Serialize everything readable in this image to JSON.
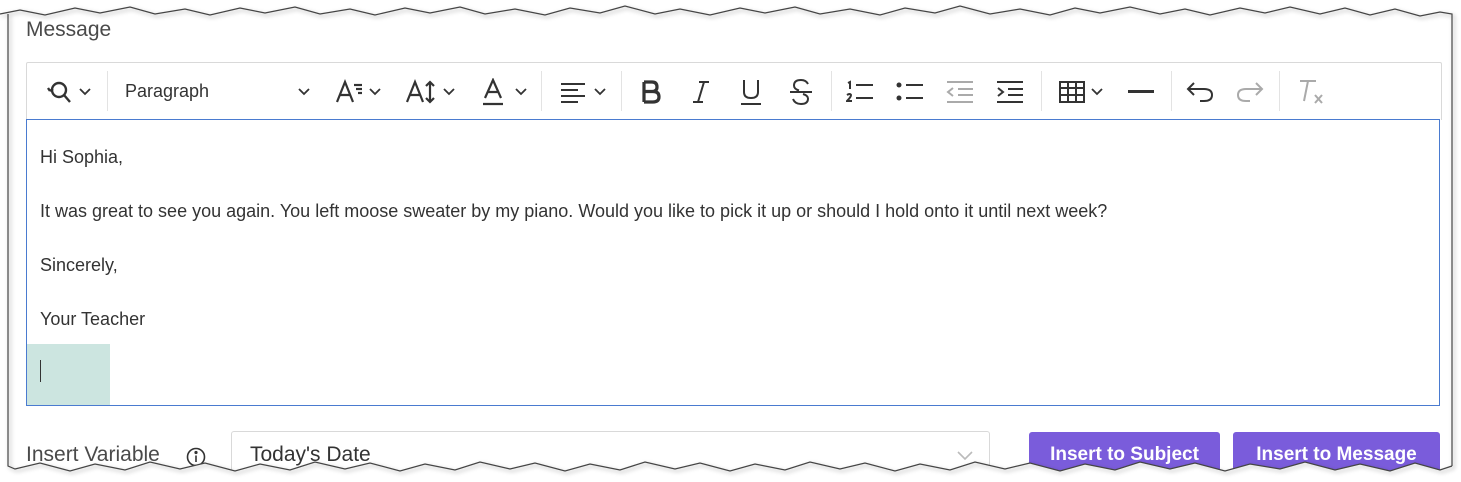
{
  "message_label": "Message",
  "toolbar": {
    "format_select": "Paragraph"
  },
  "editor": {
    "lines": [
      "Hi Sophia,",
      "It was great to see you again. You left moose sweater by my piano. Would you like to pick it up or should I hold onto it until next week?",
      "Sincerely,",
      "Your Teacher"
    ]
  },
  "insert_variable": {
    "label": "Insert Variable",
    "selected": "Today's Date"
  },
  "buttons": {
    "insert_subject": "Insert to Subject",
    "insert_message": "Insert to Message"
  },
  "colors": {
    "accent": "#7a5cdb",
    "editor_border": "#4a7bd0",
    "caret_highlight": "#cce5e0"
  }
}
